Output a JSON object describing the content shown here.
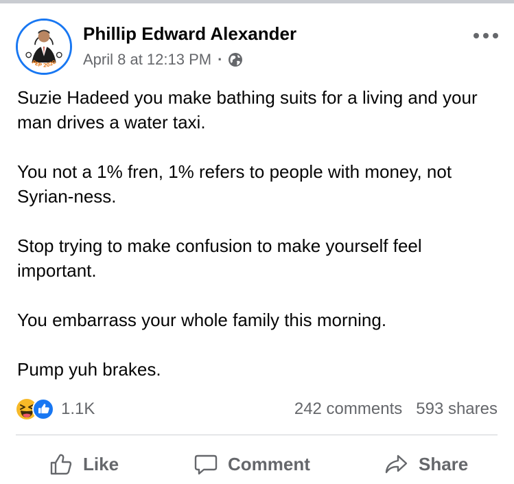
{
  "post": {
    "author": "Phillip Edward Alexander",
    "timestamp": "April 8 at 12:13 PM",
    "separator": "·",
    "privacy_icon": "globe-icon",
    "avatar_badge": "PEP 2020",
    "menu_icon": "more-options-icon",
    "paragraphs": [
      "Suzie Hadeed you make bathing suits for a living and your man drives a water taxi.",
      "You not a 1% fren, 1% refers to people with money, not Syrian-ness.",
      "Stop trying to make confusion to make yourself feel important.",
      "You embarrass your whole family this morning.",
      "Pump yuh brakes."
    ]
  },
  "stats": {
    "reaction_icons": [
      "haha-reaction-icon",
      "like-reaction-icon"
    ],
    "reaction_count": "1.1K",
    "comments": "242 comments",
    "shares": "593 shares"
  },
  "actions": {
    "like": "Like",
    "comment": "Comment",
    "share": "Share"
  },
  "colors": {
    "brand_blue": "#1877f2",
    "secondary_text": "#65676b",
    "haha_yellow": "#f7b928"
  }
}
